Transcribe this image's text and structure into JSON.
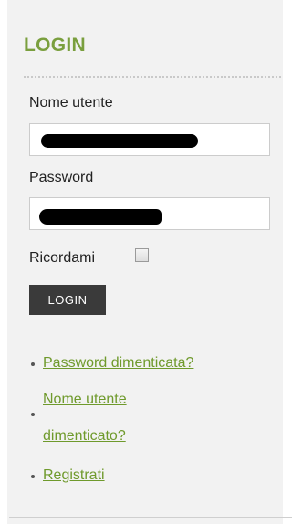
{
  "login": {
    "title": "LOGIN",
    "username_label": "Nome utente",
    "password_label": "Password",
    "remember_label": "Ricordami",
    "remember_checked": false,
    "submit_label": "LOGIN",
    "links": {
      "forgot_password": "Password dimenticata?",
      "forgot_username_line1": "Nome utente",
      "forgot_username_line2": "dimenticato?",
      "register": "Registrati"
    }
  }
}
